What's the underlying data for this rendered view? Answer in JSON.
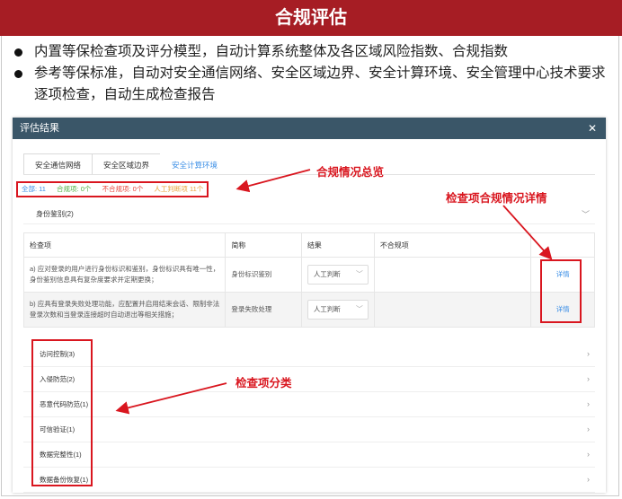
{
  "title": "合规评估",
  "bullets": [
    "内置等保检查项及评分模型，自动计算系统整体及各区域风险指数、合规指数",
    "参考等保标准，自动对安全通信网络、安全区域边界、安全计算环境、安全管理中心技术要求逐项检查，自动生成检查报告"
  ],
  "panel": {
    "title": "评估结果",
    "close_icon": "close-icon",
    "tabs": [
      "安全通信网络",
      "安全区域边界",
      "安全计算环境"
    ],
    "active_tab": 2,
    "summary": {
      "all": "全部: 11",
      "compliant": "合规项: 0个",
      "noncompliant": "不合规项: 0个",
      "manual": "人工判断项 11个"
    },
    "group": "身份鉴别(2)",
    "table": {
      "headers": [
        "检查项",
        "简称",
        "结果",
        "不合规项"
      ],
      "rows": [
        {
          "item": "a) 应对登录的用户进行身份标识和鉴别，身份标识具有唯一性，身份鉴别信息具有复杂度要求并定期更换；",
          "short": "身份标识鉴别",
          "result": "人工判断",
          "noncompliant": "",
          "action": "详情"
        },
        {
          "item": "b) 应具有登录失败处理功能，应配置并启用结束会话、限制非法登录次数和当登录连接超时自动退出等相关措施；",
          "short": "登录失败处理",
          "result": "人工判断",
          "noncompliant": "",
          "action": "详情"
        }
      ]
    },
    "categories": [
      "访问控制(3)",
      "入侵防范(2)",
      "恶意代码防范(1)",
      "可信验证(1)",
      "数据完整性(1)",
      "数据备份恢复(1)"
    ]
  },
  "annotations": {
    "summary": "合规情况总览",
    "details": "检查项合规情况详情",
    "categories": "检查项分类"
  },
  "colors": {
    "title_bg": "#a61d24",
    "panel_header": "#3a5668",
    "accent": "#3a8ee6",
    "annotation": "#d9161f",
    "compliant": "#52b043",
    "noncompliant": "#e8453c",
    "manual": "#e8a33c"
  }
}
